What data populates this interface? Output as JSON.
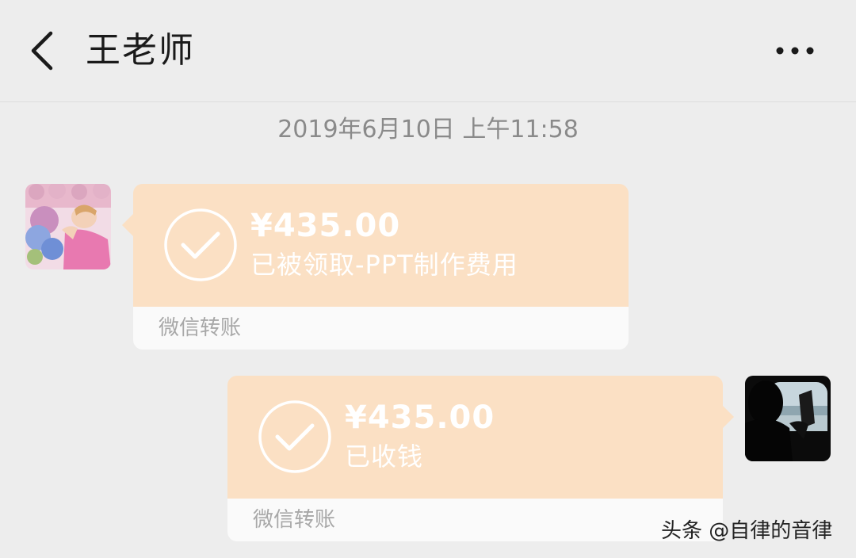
{
  "header": {
    "back_icon": "chevron-left-icon",
    "title": "王老师",
    "more_icon": "more-horizontal-icon"
  },
  "timestamp": "2019年6月10日 上午11:58",
  "messages": [
    {
      "side": "left",
      "avatar": "avatar-girl-with-hydrangeas",
      "amount": "¥435.00",
      "status": "已被领取-PPT制作费用",
      "label": "微信转账",
      "icon": "check-circle-icon"
    },
    {
      "side": "right",
      "avatar": "avatar-silhouette-reading",
      "amount": "¥435.00",
      "status": "已收钱",
      "label": "微信转账",
      "icon": "check-circle-icon"
    }
  ],
  "watermark": "头条 @自律的音律",
  "colors": {
    "background": "#ededed",
    "card_accent": "#fbe0c4",
    "card_footer": "#fafafa",
    "timestamp_text": "#8a8a8a"
  }
}
